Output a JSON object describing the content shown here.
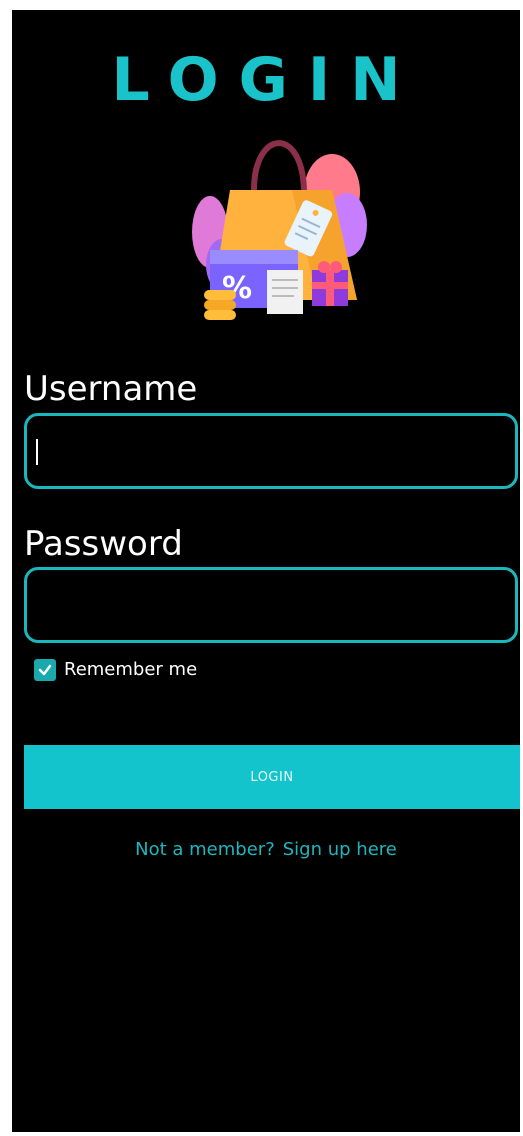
{
  "header": {
    "title": "LOGIN"
  },
  "form": {
    "username_label": "Username",
    "username_value": "",
    "password_label": "Password",
    "password_value": "",
    "remember_label": "Remember me",
    "remember_checked": true,
    "login_button_label": "LOGIN"
  },
  "footer": {
    "prompt_text": "Not a member?",
    "signup_link": "Sign up here"
  },
  "colors": {
    "accent": "#19c3c9",
    "background": "#000000",
    "text": "#ffffff"
  },
  "icons": {
    "illustration": "shopping-bag-illustration",
    "checkbox": "check-icon"
  }
}
